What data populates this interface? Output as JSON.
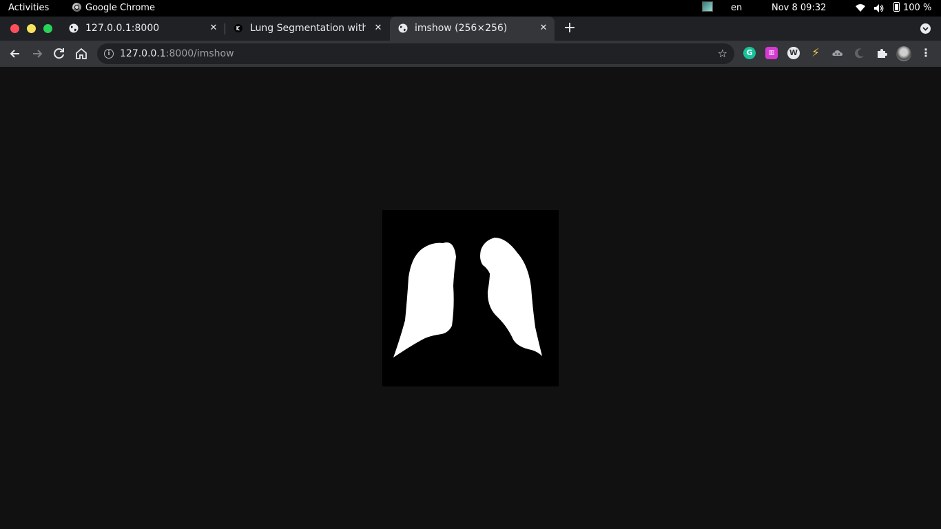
{
  "topbar": {
    "activities": "Activities",
    "app_name": "Google Chrome",
    "language": "en",
    "datetime": "Nov 8  09:32",
    "battery": "100 %"
  },
  "tabs": [
    {
      "title": "127.0.0.1:8000",
      "close": "✕",
      "favicon": "globe-icon"
    },
    {
      "title": "Lung Segmentation with",
      "close": "✕",
      "favicon": "kaggle-icon"
    },
    {
      "title": "imshow (256×256)",
      "close": "✕",
      "favicon": "globe-icon",
      "active": true
    }
  ],
  "new_tab": "+",
  "toolbar": {
    "url_host": "127.0.0.1",
    "url_path": ":8000/imshow",
    "extensions": [
      "grammarly-icon",
      "extension-icon",
      "wappalyzer-icon",
      "lightning-icon",
      "cloud-extension-icon",
      "moon-icon",
      "puzzle-icon",
      "avatar",
      "menu-icon"
    ]
  },
  "image": {
    "description_size": "256×256"
  },
  "colors": {
    "topbar": "#000000",
    "tabstrip": "#202124",
    "toolbar": "#35363a",
    "page_bg": "#111111"
  }
}
